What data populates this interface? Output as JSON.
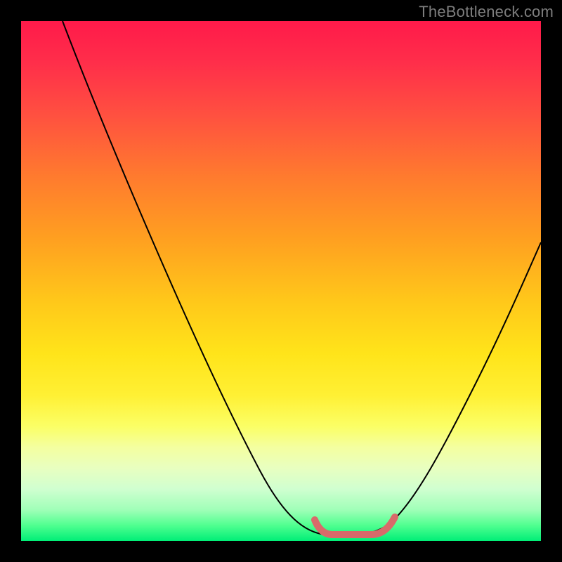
{
  "watermark": "TheBottleneck.com",
  "chart_data": {
    "type": "line",
    "title": "",
    "xlabel": "",
    "ylabel": "",
    "xlim": [
      0,
      100
    ],
    "ylim": [
      0,
      100
    ],
    "grid": false,
    "series": [
      {
        "name": "bottleneck-curve",
        "x": [
          8,
          15,
          22,
          30,
          38,
          46,
          52,
          56,
          59.5,
          62,
          66,
          70,
          73,
          78,
          84,
          90,
          96,
          100
        ],
        "y": [
          100,
          86,
          72,
          57,
          42,
          27,
          15,
          7,
          2,
          0.5,
          0.5,
          1.5,
          5,
          13,
          25,
          38,
          50,
          58
        ]
      }
    ],
    "annotations": [
      {
        "name": "optimal-band",
        "x_range": [
          59,
          73
        ],
        "y_approx": 1.5,
        "color": "#d86a6a"
      }
    ],
    "background": {
      "type": "gradient-vertical",
      "stops": [
        {
          "pos": 0,
          "color": "#ff1a4a"
        },
        {
          "pos": 50,
          "color": "#ffc81a"
        },
        {
          "pos": 80,
          "color": "#f4ffa0"
        },
        {
          "pos": 100,
          "color": "#00ee77"
        }
      ]
    }
  }
}
